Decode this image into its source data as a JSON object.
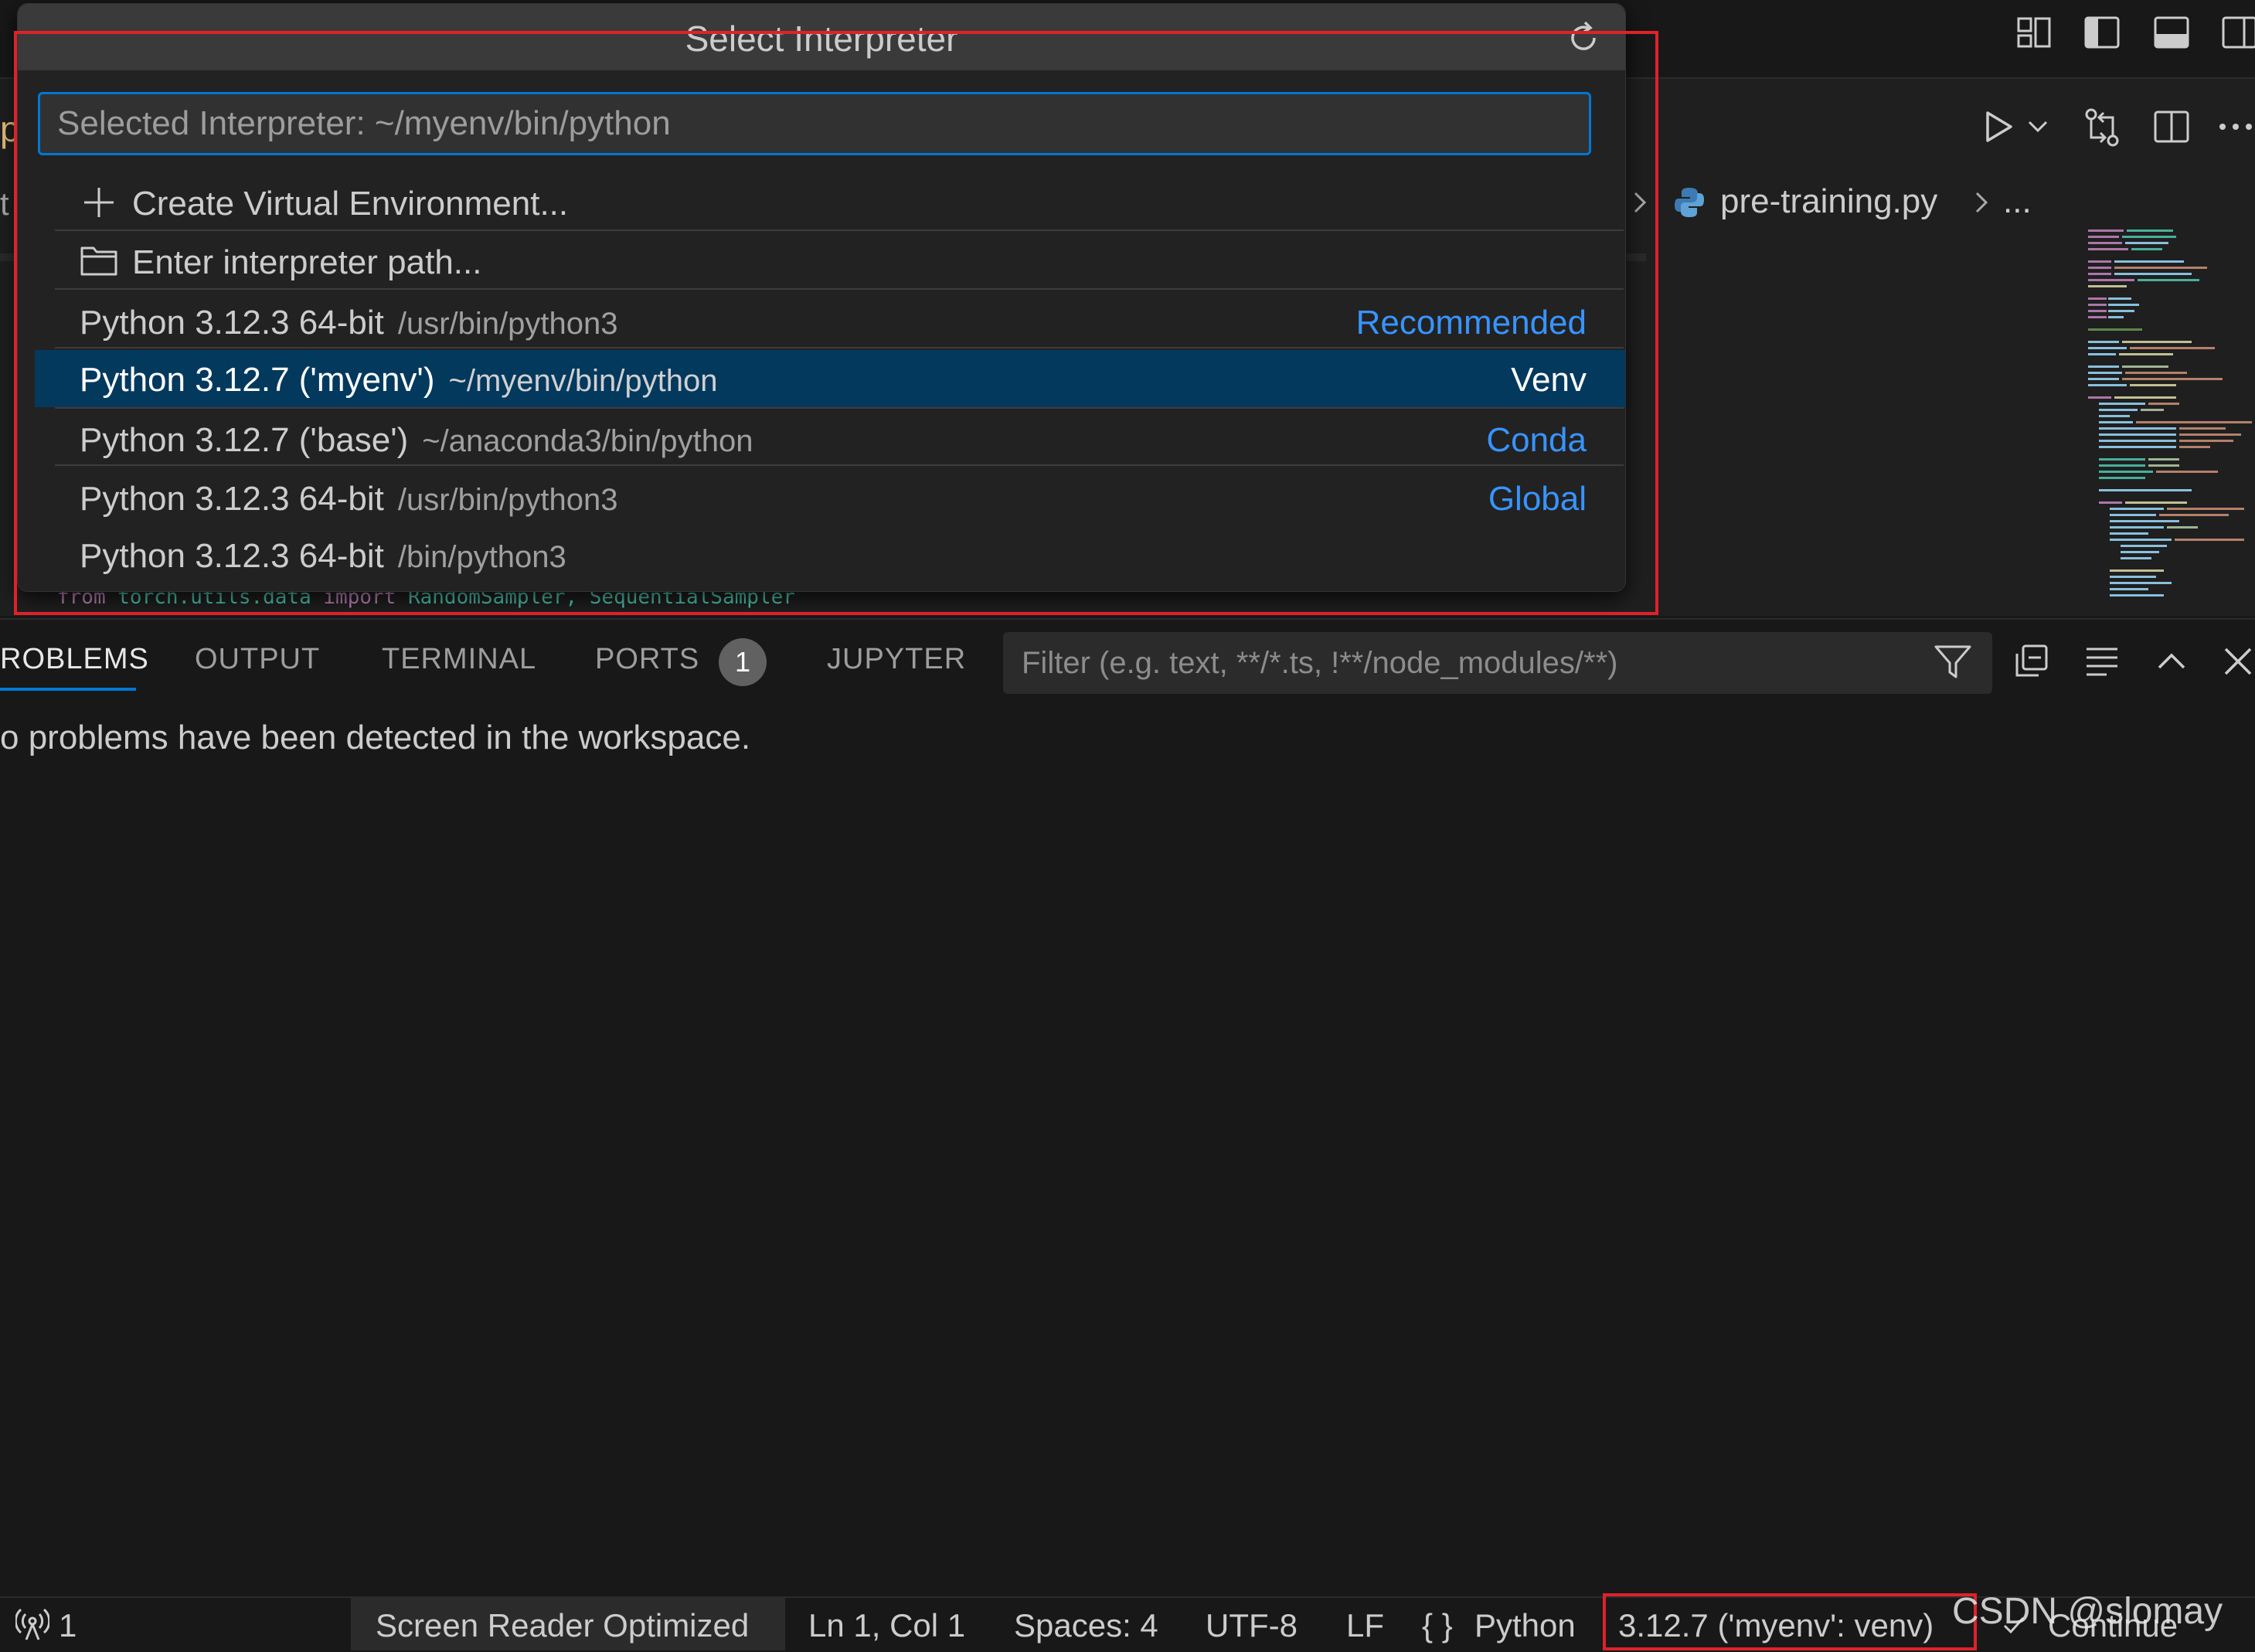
{
  "quick_pick": {
    "title": "Select Interpreter",
    "input_placeholder": "Selected Interpreter: ~/myenv/bin/python",
    "actions": {
      "create_venv": "Create Virtual Environment...",
      "enter_path": "Enter interpreter path..."
    },
    "items": [
      {
        "label": "Python 3.12.3 64-bit",
        "description": "/usr/bin/python3",
        "badge": "Recommended",
        "selected": false
      },
      {
        "label": "Python 3.12.7 ('myenv')",
        "description": "~/myenv/bin/python",
        "badge": "Venv",
        "selected": true
      },
      {
        "label": "Python 3.12.7 ('base')",
        "description": "~/anaconda3/bin/python",
        "badge": "Conda",
        "selected": false
      },
      {
        "label": "Python 3.12.3 64-bit",
        "description": "/usr/bin/python3",
        "badge": "Global",
        "selected": false
      },
      {
        "label": "Python 3.12.3 64-bit",
        "description": "/bin/python3",
        "badge": "",
        "selected": false
      }
    ]
  },
  "editor": {
    "breadcrumb_file": "pre-training.py",
    "breadcrumb_more": "...",
    "tab_left_fragment": "p",
    "breadcrumb_left_fragment": "t",
    "code_line": {
      "kw1": "from",
      "module": "torch.utils.data",
      "kw2": "import",
      "names": "RandomSampler, SequentialSampler"
    }
  },
  "panel": {
    "tabs": [
      "ROBLEMS",
      "OUTPUT",
      "TERMINAL",
      "PORTS",
      "JUPYTER"
    ],
    "ports_count": "1",
    "filter_placeholder": "Filter (e.g. text, **/*.ts, !**/node_modules/**)",
    "message": "o problems have been detected in the workspace."
  },
  "status_bar": {
    "ports": "1",
    "screen_reader": "Screen Reader Optimized",
    "position": "Ln 1, Col 1",
    "spaces": "Spaces: 4",
    "encoding": "UTF-8",
    "eol": "LF",
    "language_icon": "{ }",
    "language": "Python",
    "interpreter": "3.12.7 ('myenv': venv)",
    "continue": "Continue"
  },
  "watermark": "CSDN @slomay",
  "colors": {
    "accent": "#0078d4",
    "badge_blue": "#3794ff",
    "selected_row": "#04395e",
    "annotation_red": "#e0212a"
  }
}
